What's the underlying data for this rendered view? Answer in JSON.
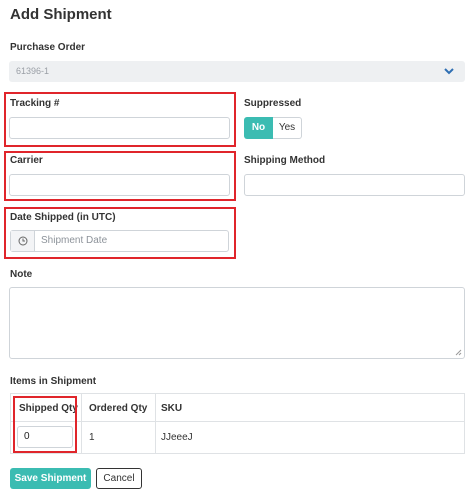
{
  "title": "Add Shipment",
  "purchase_order": {
    "label": "Purchase Order",
    "value": "61396-1"
  },
  "tracking": {
    "label": "Tracking #",
    "value": ""
  },
  "suppressed": {
    "label": "Suppressed",
    "options": [
      "No",
      "Yes"
    ],
    "selected": "No"
  },
  "carrier": {
    "label": "Carrier",
    "value": ""
  },
  "shipping_method": {
    "label": "Shipping Method",
    "value": ""
  },
  "date_shipped": {
    "label": "Date Shipped (in UTC)",
    "placeholder": "Shipment Date",
    "icon": "clock-icon"
  },
  "note": {
    "label": "Note",
    "value": ""
  },
  "items": {
    "label": "Items in Shipment",
    "columns": [
      "Shipped Qty",
      "Ordered Qty",
      "SKU"
    ],
    "rows": [
      {
        "shipped_qty": "0",
        "ordered_qty": "1",
        "sku": "JJeeeJ"
      }
    ]
  },
  "buttons": {
    "save": "Save Shipment",
    "cancel": "Cancel"
  },
  "colors": {
    "accent": "#3bbcb2",
    "highlight": "#e0252b"
  }
}
